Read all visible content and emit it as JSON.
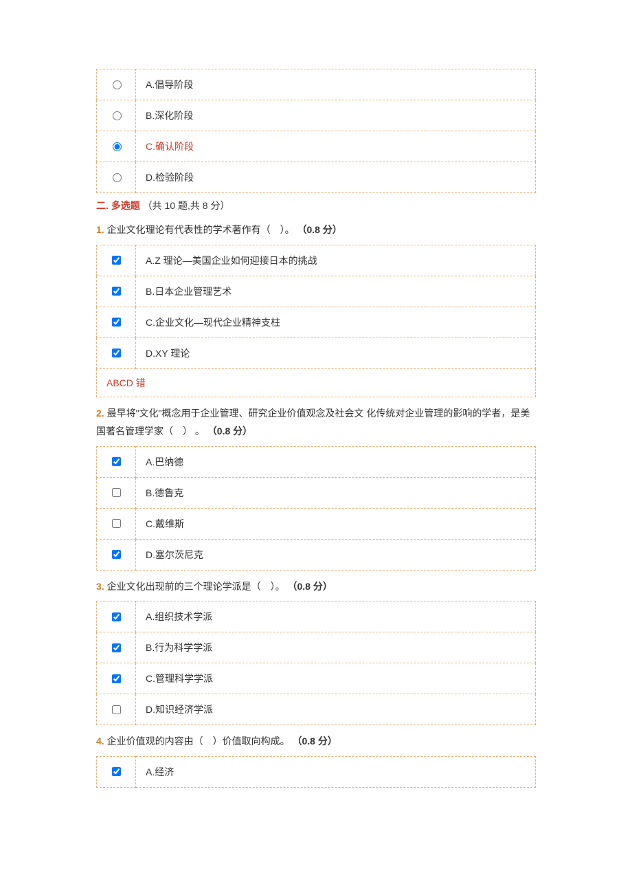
{
  "prev_question": {
    "options": [
      {
        "label": "A.倡导阶段",
        "checked": false,
        "selected": false
      },
      {
        "label": "B.深化阶段",
        "checked": false,
        "selected": false
      },
      {
        "label": "C.确认阶段",
        "checked": true,
        "selected": true
      },
      {
        "label": "D.检验阶段",
        "checked": false,
        "selected": false
      }
    ]
  },
  "section2": {
    "prefix": "二.",
    "title": " 多选题",
    "suffix": "（共 10 题,共 8 分）"
  },
  "questions": [
    {
      "num": "1.",
      "text": " 企业文化理论有代表性的学术著作有（　）。 ",
      "points": "（0.8 分）",
      "options": [
        {
          "label": "A.Z 理论—美国企业如何迎接日本的挑战",
          "checked": true
        },
        {
          "label": "B.日本企业管理艺术",
          "checked": true
        },
        {
          "label": "C.企业文化—现代企业精神支柱",
          "checked": true
        },
        {
          "label": "D.XY 理论",
          "checked": true
        }
      ],
      "feedback": "ABCD 错"
    },
    {
      "num": "2.",
      "text": " 最早将\"文化\"概念用于企业管理、研究企业价值观念及社会文 化传统对企业管理的影响的学者，是美国著名管理学家（　） 。 ",
      "points": "（0.8 分）",
      "options": [
        {
          "label": "A.巴纳德",
          "checked": true
        },
        {
          "label": "B.德鲁克",
          "checked": false
        },
        {
          "label": "C.戴维斯",
          "checked": false
        },
        {
          "label": "D.塞尔茨尼克",
          "checked": true
        }
      ]
    },
    {
      "num": "3.",
      "text": " 企业文化出现前的三个理论学派是（　）。 ",
      "points": "（0.8 分）",
      "options": [
        {
          "label": "A.组织技术学派",
          "checked": true
        },
        {
          "label": "B.行为科学学派",
          "checked": true
        },
        {
          "label": "C.管理科学学派",
          "checked": true
        },
        {
          "label": "D.知识经济学派",
          "checked": false
        }
      ]
    },
    {
      "num": "4.",
      "text": " 企业价值观的内容由（　）价值取向构成。 ",
      "points": "（0.8 分）",
      "options": [
        {
          "label": "A.经济",
          "checked": true
        }
      ]
    }
  ]
}
